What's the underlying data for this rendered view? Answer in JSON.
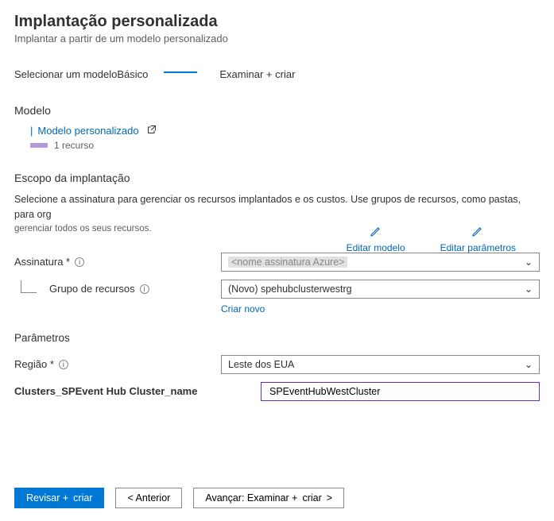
{
  "header": {
    "title": "Implantação personalizada",
    "subtitle": "Implantar a partir de um modelo personalizado"
  },
  "tabs": {
    "select_template": "Selecionar um modelo",
    "basics": "Básico",
    "review_prefix": "Examinar +",
    "review_create": "criar"
  },
  "template": {
    "section": "Modelo",
    "link_text": "Modelo personalizado",
    "resource_count": "1 recurso",
    "edit_template": "Editar modelo",
    "edit_parameters": "Editar parâmetros"
  },
  "scope": {
    "header": "Escopo da implantação",
    "desc": "Selecione a assinatura para gerenciar os recursos implantados e os custos. Use grupos de recursos, como pastas, para org",
    "desc2": "gerenciar todos os seus recursos."
  },
  "form": {
    "subscription_label": "Assinatura",
    "subscription_value": "<nome assinatura Azure>",
    "resource_group_label": "Grupo de recursos",
    "resource_group_value": "(Novo) spehubclusterwestrg",
    "create_new": "Criar novo"
  },
  "params": {
    "header": "Parâmetros",
    "region_label": "Região",
    "region_value": "Leste dos EUA",
    "cluster_label": "Clusters_SPEvent Hub Cluster_name",
    "cluster_value": "SPEventHubWestCluster"
  },
  "footer": {
    "review_prefix": "Revisar +",
    "review_create": "criar",
    "previous": "<  Anterior",
    "next_prefix": "Avançar: Examinar +",
    "next_create": "criar",
    "next_suffix": ">"
  }
}
